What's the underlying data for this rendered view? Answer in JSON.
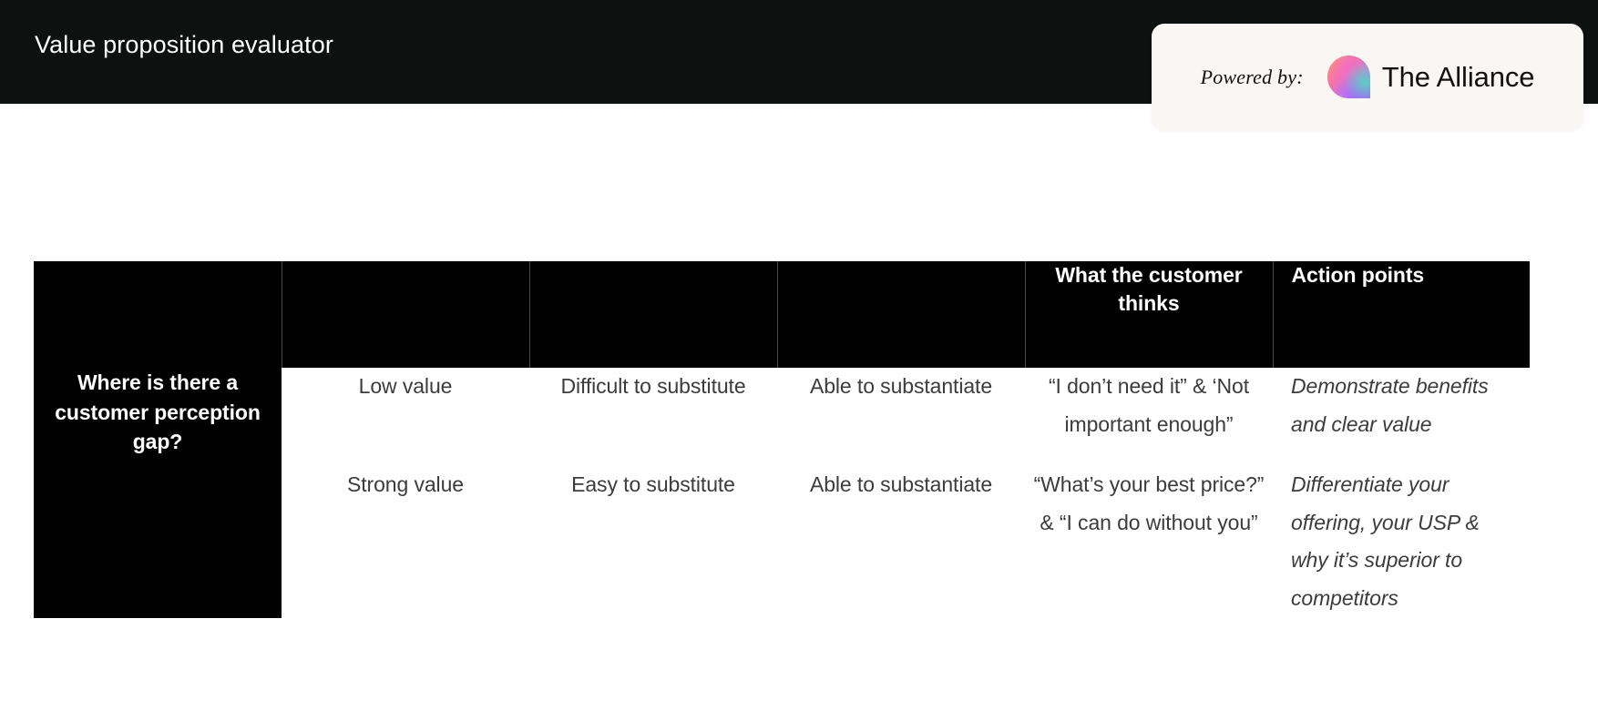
{
  "header": {
    "title": "Value proposition evaluator",
    "badge": {
      "powered_label": "Powered by:",
      "brand_name": "The Alliance",
      "logo_icon": "alliance-droplet-gradient-icon"
    },
    "bar_color": "#0d1211",
    "badge_bg": "#f9f7f4"
  },
  "table": {
    "columns": [
      {
        "key": "gap",
        "label": "Where is there a customer perception gap?"
      },
      {
        "key": "value",
        "label": ""
      },
      {
        "key": "sub",
        "label": ""
      },
      {
        "key": "subst",
        "label": ""
      },
      {
        "key": "think",
        "label": "What the customer thinks"
      },
      {
        "key": "act",
        "label": "Action points"
      }
    ],
    "header_bg": "#000000",
    "header_color": "#ffffff",
    "body_color": "#3c3c3c",
    "rows": [
      {
        "value": "Low value",
        "sub": "Difficult to substitute",
        "subst": "Able to substantiate",
        "think": "“I don’t need it” & ‘Not important enough”",
        "act": "Demonstrate benefits and clear value"
      },
      {
        "value": "Strong value",
        "sub": "Easy to substitute",
        "subst": "Able to substantiate",
        "think": "“What’s your best price?” & “I can do without you”",
        "act": "Differentiate your offering, your USP & why it’s superior to competitors"
      }
    ]
  }
}
